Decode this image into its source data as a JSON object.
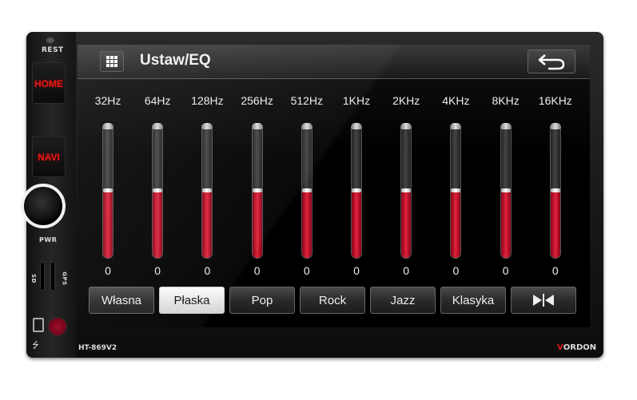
{
  "device": {
    "reset_label": "REST",
    "home_label": "HOME",
    "navi_label": "NAVI",
    "pwr_label": "PWR",
    "sd_label": "SD",
    "gps_label": "GPS",
    "model": "HT-869V2",
    "brand_first": "V",
    "brand_rest": "ORDON"
  },
  "header": {
    "title": "Ustaw/EQ",
    "menu_icon": "grid-menu-icon",
    "back_icon": "back-arrow-icon"
  },
  "equalizer": {
    "level_range": [
      -10,
      10
    ],
    "bands": [
      {
        "label": "32Hz",
        "value": "0",
        "level": 0
      },
      {
        "label": "64Hz",
        "value": "0",
        "level": 0
      },
      {
        "label": "128Hz",
        "value": "0",
        "level": 0
      },
      {
        "label": "256Hz",
        "value": "0",
        "level": 0
      },
      {
        "label": "512Hz",
        "value": "0",
        "level": 0
      },
      {
        "label": "1KHz",
        "value": "0",
        "level": 0
      },
      {
        "label": "2KHz",
        "value": "0",
        "level": 0
      },
      {
        "label": "4KHz",
        "value": "0",
        "level": 0
      },
      {
        "label": "8KHz",
        "value": "0",
        "level": 0
      },
      {
        "label": "16KHz",
        "value": "0",
        "level": 0
      }
    ]
  },
  "presets": [
    {
      "label": "Własna",
      "active": false
    },
    {
      "label": "Płaska",
      "active": true
    },
    {
      "label": "Pop",
      "active": false
    },
    {
      "label": "Rock",
      "active": false
    },
    {
      "label": "Jazz",
      "active": false
    },
    {
      "label": "Klasyka",
      "active": false
    }
  ],
  "balance_icon": "speaker-balance-icon",
  "colors": {
    "accent_red": "#e0243c",
    "hw_label_red": "#e21a1a"
  }
}
